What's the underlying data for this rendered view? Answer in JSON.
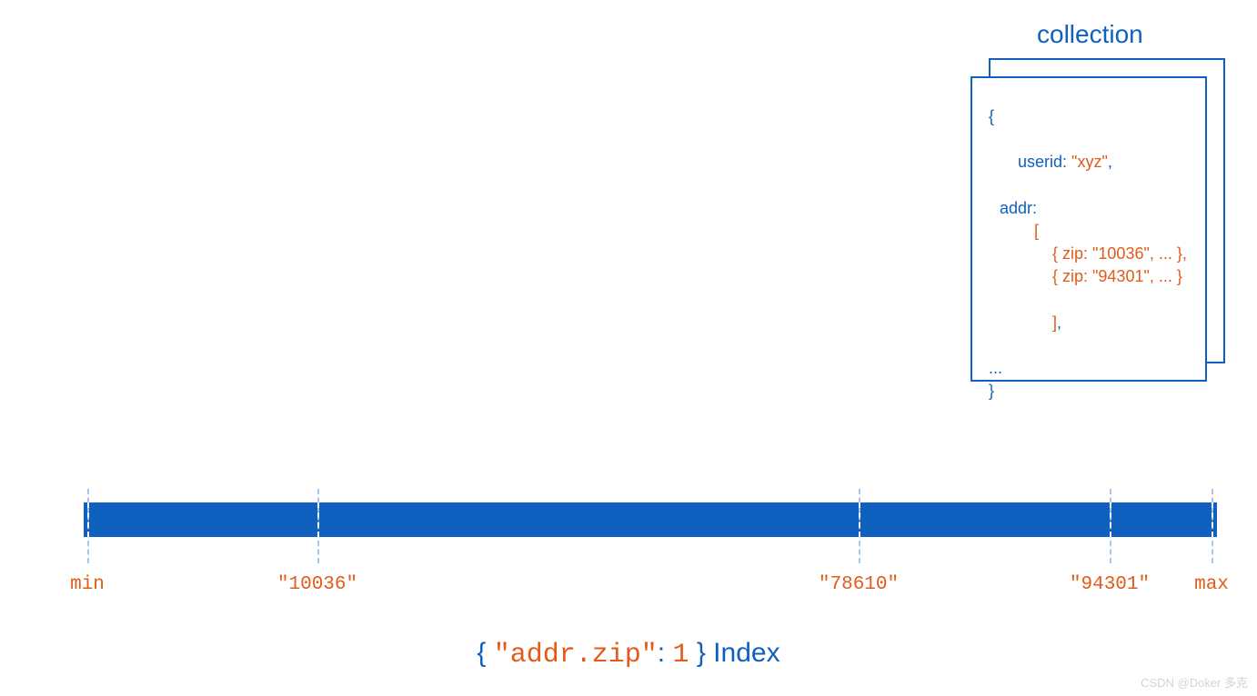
{
  "collection_label": "collection",
  "document": {
    "open": "{",
    "userid_key": "userid:",
    "userid_val": " \"xyz\"",
    "comma": ",",
    "addr_key": "addr:",
    "arr_open": "[",
    "zip1": "{ zip: \"10036\", ... },",
    "zip2": "{ zip: \"94301\", ... }",
    "arr_close": "]",
    "trailing_comma": ",",
    "ellipsis": "...",
    "close": "}"
  },
  "ticks": [
    {
      "pos": 96,
      "label": "min"
    },
    {
      "pos": 349,
      "label": "\"10036\""
    },
    {
      "pos": 944,
      "label": "\"78610\""
    },
    {
      "pos": 1220,
      "label": "\"94301\""
    },
    {
      "pos": 1332,
      "label": "max"
    }
  ],
  "index_spec": {
    "open": "{ ",
    "key": "\"addr.zip\"",
    "colon": ": ",
    "value": "1",
    "close": " }",
    "word": " Index"
  },
  "watermark": "CSDN @Doker 多克",
  "colors": {
    "blue": "#1060c0",
    "orange": "#e25b1a",
    "tick": "#a6c8e8"
  }
}
